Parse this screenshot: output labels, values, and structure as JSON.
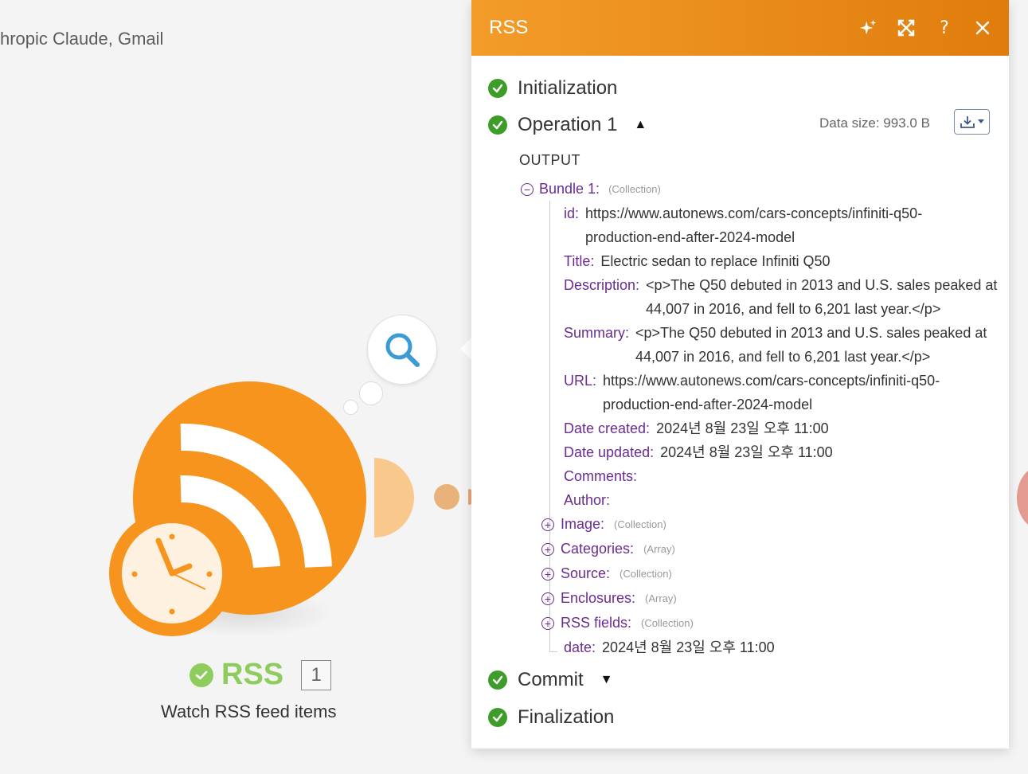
{
  "scenario": {
    "title": "hropic Claude, Gmail"
  },
  "module": {
    "name": "RSS",
    "badge": "1",
    "subtitle": "Watch RSS feed items"
  },
  "panel": {
    "title": "RSS",
    "steps": {
      "initialization": "Initialization",
      "operation": "Operation 1",
      "commit": "Commit",
      "finalization": "Finalization"
    },
    "data_size": "Data size: 993.0 B",
    "output_label": "OUTPUT",
    "bundle": {
      "label": "Bundle 1:",
      "type": "(Collection)"
    },
    "fields": {
      "id": {
        "key": "id:",
        "value": "https://www.autonews.com/cars-concepts/infiniti-q50-\nproduction-end-after-2024-model"
      },
      "title": {
        "key": "Title:",
        "value": "Electric sedan to replace Infiniti Q50"
      },
      "description": {
        "key": "Description:",
        "value": "<p>The Q50 debuted in 2013 and U.S. sales peaked at\n44,007 in 2016, and fell to 6,201 last year.</p>"
      },
      "summary": {
        "key": "Summary:",
        "value": "<p>The Q50 debuted in 2013 and U.S. sales peaked at\n44,007 in 2016, and fell to 6,201 last year.</p>"
      },
      "url": {
        "key": "URL:",
        "value": "https://www.autonews.com/cars-concepts/infiniti-q50-\nproduction-end-after-2024-model"
      },
      "date_created": {
        "key": "Date created:",
        "value": "2024년 8월 23일 오후 11:00"
      },
      "date_updated": {
        "key": "Date updated:",
        "value": "2024년 8월 23일 오후 11:00"
      },
      "comments": {
        "key": "Comments:",
        "value": ""
      },
      "author": {
        "key": "Author:",
        "value": ""
      },
      "date": {
        "key": "date:",
        "value": "2024년 8월 23일 오후 11:00"
      }
    },
    "collections": {
      "image": {
        "key": "Image:",
        "type": "(Collection)"
      },
      "categories": {
        "key": "Categories:",
        "type": "(Array)"
      },
      "source": {
        "key": "Source:",
        "type": "(Collection)"
      },
      "enclosures": {
        "key": "Enclosures:",
        "type": "(Array)"
      },
      "rss_fields": {
        "key": "RSS fields:",
        "type": "(Collection)"
      }
    }
  },
  "colors": {
    "accent": "#f7941d",
    "header_start": "#f39c2a",
    "header_end": "#e07c0c",
    "success": "#3d9d28",
    "key": "#6a2c91",
    "module_ok": "#8fcc5e"
  },
  "icons": [
    "sparkle-icon",
    "expand-icon",
    "help-icon",
    "close-icon",
    "download-icon",
    "chevron-down-icon",
    "search-icon",
    "rss-icon",
    "clock-icon",
    "check-icon"
  ]
}
